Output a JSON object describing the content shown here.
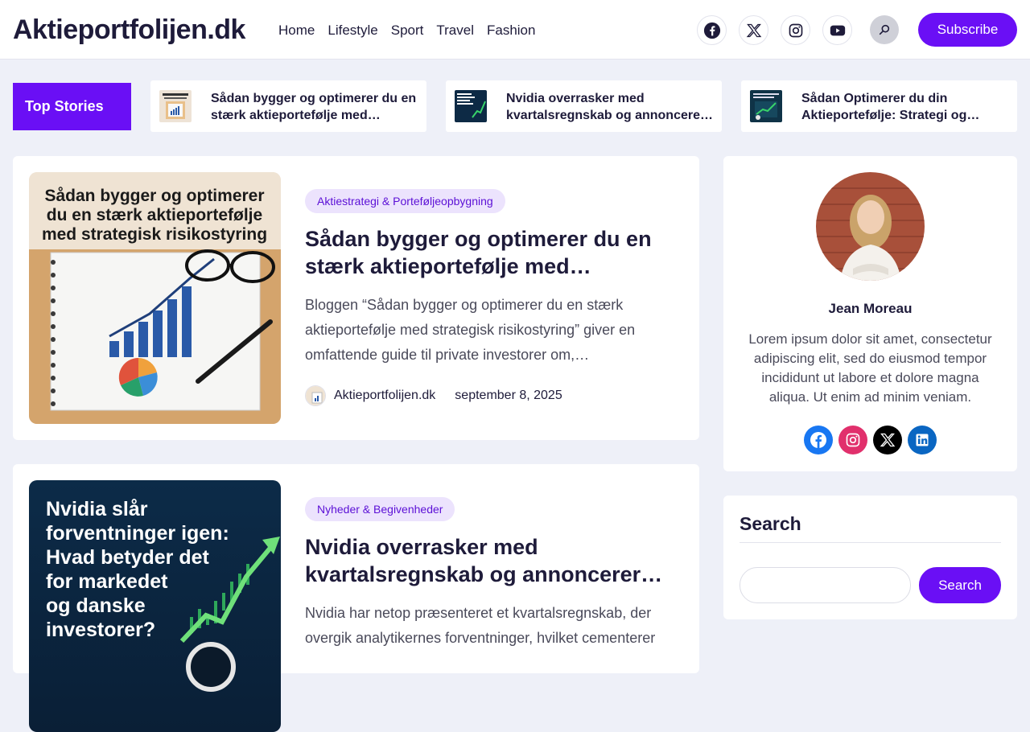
{
  "header": {
    "logo": "Aktieportfolijen.dk",
    "nav": [
      "Home",
      "Lifestyle",
      "Sport",
      "Travel",
      "Fashion"
    ],
    "social_icons": [
      "facebook-icon",
      "x-icon",
      "instagram-icon",
      "youtube-icon"
    ],
    "subscribe_label": "Subscribe"
  },
  "top_stories": {
    "label": "Top Stories",
    "items": [
      {
        "title": "Sådan bygger og optimerer du en stærk aktieportefølje med strategisk risikostyring"
      },
      {
        "title": "Nvidia overrasker med kvartalsregnskab og annoncerer aktietilbagekøb"
      },
      {
        "title": "Sådan Optimerer du din Aktieportefølje: Strategi og Risikostyring"
      }
    ]
  },
  "posts": [
    {
      "category": "Aktiestrategi & Porteføljeopbygning",
      "title": "Sådan bygger og optimerer du en stærk aktieportefølje med strategisk risikostyring",
      "excerpt": "Bloggen “Sådan bygger og optimerer du en stærk aktieportefølje med strategisk risikostyring” giver en omfattende guide til private investorer om,…",
      "author": "Aktieportfolijen.dk",
      "date": "september 8, 2025",
      "image_text": "Sådan bygger og optimerer du en stærk aktieportefølje med strategisk risikostyring"
    },
    {
      "category": "Nyheder & Begivenheder",
      "title": "Nvidia overrasker med kvartalsregnskab og annoncerer aktietilbagekøb",
      "excerpt": "Nvidia har netop præsenteret et kvartalsregnskab, der overgik analytikernes forventninger, hvilket cementerer",
      "image_text": "Nvidia slår forventninger igen: Hvad betyder det for markedet og danske investorer?"
    }
  ],
  "sidebar": {
    "author_name": "Jean Moreau",
    "author_bio": "Lorem ipsum dolor sit amet, consectetur adipiscing elit, sed do eiusmod tempor incididunt ut labore et dolore magna aliqua. Ut enim ad minim veniam.",
    "social_icons": [
      "facebook-icon",
      "instagram-icon",
      "x-icon",
      "linkedin-icon"
    ],
    "search_heading": "Search",
    "search_placeholder": "",
    "search_button": "Search"
  },
  "colors": {
    "accent": "#6a0ff5",
    "background": "#eef0f8",
    "badge_bg": "#ece3fd",
    "badge_text": "#5b0fd6",
    "facebook": "#1877f2",
    "instagram": "#e1306c",
    "linkedin": "#0a66c2"
  }
}
